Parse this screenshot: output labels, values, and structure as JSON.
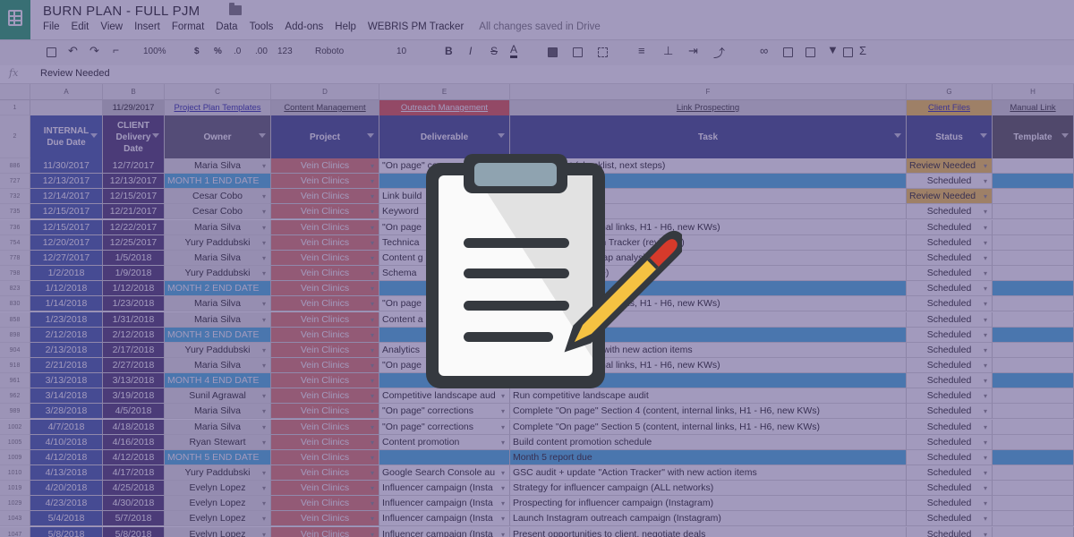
{
  "doc": {
    "title": "BURN PLAN - FULL PJM",
    "menu": [
      "File",
      "Edit",
      "View",
      "Insert",
      "Format",
      "Data",
      "Tools",
      "Add-ons",
      "Help",
      "WEBRIS PM Tracker"
    ],
    "saved_status": "All changes saved in Drive"
  },
  "toolbar": {
    "zoom": "100%",
    "currency": "$",
    "percent": "%",
    "dec_less": ".0",
    "dec_more": ".00",
    "format_more": "123",
    "font": "Roboto",
    "font_size": "10",
    "bold": "B",
    "italic": "I",
    "strike": "S",
    "text_color": "A",
    "sum": "Σ"
  },
  "formula": {
    "fx_label": "fx",
    "value": "Review Needed"
  },
  "columns": [
    "A",
    "B",
    "C",
    "D",
    "E",
    "F",
    "G",
    "H"
  ],
  "row1": {
    "row_number": "1",
    "b": "11/29/2017",
    "c": "Project Plan Templates",
    "d": "Content Management",
    "e": "Outreach Management",
    "f": "Link Prospecting",
    "g": "Client Files",
    "h": "Manual Link"
  },
  "headers": {
    "row_number": "2",
    "a": "INTERNAL Due Date",
    "b": "CLIENT Delivery Date",
    "c": "Owner",
    "d": "Project",
    "e": "Deliverable",
    "f": "Task",
    "g": "Status",
    "h": "Template"
  },
  "rows": [
    {
      "n": "886",
      "a": "11/30/2017",
      "b": "12/7/2017",
      "c": "Maria Silva",
      "d": "Vein Clinics",
      "e": "\"On page\" co",
      "f": "ead document (checklist, next steps)",
      "g": "Review Needed"
    },
    {
      "n": "727",
      "a": "12/13/2017",
      "b": "12/13/2017",
      "c": "MONTH 1 END DATE",
      "d": "Vein Clinics",
      "e": "",
      "f": "",
      "g": "Scheduled",
      "m": true
    },
    {
      "n": "732",
      "a": "12/14/2017",
      "b": "12/15/2017",
      "c": "Cesar Cobo",
      "d": "Vein Clinics",
      "e": "Link build",
      "f": "ategy deck",
      "g": "Review Needed"
    },
    {
      "n": "735",
      "a": "12/15/2017",
      "b": "12/21/2017",
      "c": "Cesar Cobo",
      "d": "Vein Clinics",
      "e": "Keyword",
      "f": "",
      "g": "Scheduled"
    },
    {
      "n": "736",
      "a": "12/15/2017",
      "b": "12/22/2017",
      "c": "Maria Silva",
      "d": "Vein Clinics",
      "e": "\"On page",
      "f": "ction 1 (content, internal links, H1 - H6, new KWs)",
      "g": "Scheduled"
    },
    {
      "n": "754",
      "a": "12/20/2017",
      "b": "12/25/2017",
      "c": "Yury Paddubski",
      "d": "Vein Clinics",
      "e": "Technica",
      "f": "cklist) + Update Action Tracker (reviewer)",
      "g": "Scheduled"
    },
    {
      "n": "778",
      "a": "12/27/2017",
      "b": "1/5/2018",
      "c": "Maria Silva",
      "d": "Vein Clinics",
      "e": "Content g",
      "f": "tions (based on KW gap analysis)",
      "g": "Scheduled"
    },
    {
      "n": "798",
      "a": "1/2/2018",
      "b": "1/9/2018",
      "c": "Yury Paddubski",
      "d": "Vein Clinics",
      "e": "Schema",
      "f": "ndations File (sitewide)",
      "g": "Scheduled"
    },
    {
      "n": "823",
      "a": "1/12/2018",
      "b": "1/12/2018",
      "c": "MONTH 2 END DATE",
      "d": "Vein Clinics",
      "e": "",
      "f": "",
      "g": "Scheduled",
      "m": true
    },
    {
      "n": "830",
      "a": "1/14/2018",
      "b": "1/23/2018",
      "c": "Maria Silva",
      "d": "Vein Clinics",
      "e": "\"On page",
      "f": "ction 2 (content, internal links, H1 - H6, new KWs)",
      "g": "Scheduled"
    },
    {
      "n": "858",
      "a": "1/23/2018",
      "b": "1/31/2018",
      "c": "Maria Silva",
      "d": "Vein Clinics",
      "e": "Content a",
      "f": "posts) use WQA",
      "g": "Scheduled"
    },
    {
      "n": "898",
      "a": "2/12/2018",
      "b": "2/12/2018",
      "c": "MONTH 3 END DATE",
      "d": "Vein Clinics",
      "e": "",
      "f": "",
      "g": "Scheduled",
      "m": true
    },
    {
      "n": "904",
      "a": "2/13/2018",
      "b": "2/17/2018",
      "c": "Yury Paddubski",
      "d": "Vein Clinics",
      "e": "Analytics",
      "f": "date \"Action Tracker\" with new action items",
      "g": "Scheduled"
    },
    {
      "n": "918",
      "a": "2/21/2018",
      "b": "2/27/2018",
      "c": "Maria Silva",
      "d": "Vein Clinics",
      "e": "\"On page",
      "f": "ction 3 (content, internal links, H1 - H6, new KWs)",
      "g": "Scheduled"
    },
    {
      "n": "961",
      "a": "3/13/2018",
      "b": "3/13/2018",
      "c": "MONTH 4 END DATE",
      "d": "Vein Clinics",
      "e": "",
      "f": "",
      "g": "Scheduled",
      "m": true
    },
    {
      "n": "962",
      "a": "3/14/2018",
      "b": "3/19/2018",
      "c": "Sunil Agrawal",
      "d": "Vein Clinics",
      "e": "Competitive landscape aud",
      "f": "Run competitive landscape audit",
      "g": "Scheduled"
    },
    {
      "n": "989",
      "a": "3/28/2018",
      "b": "4/5/2018",
      "c": "Maria Silva",
      "d": "Vein Clinics",
      "e": "\"On page\" corrections",
      "f": "Complete \"On page\" Section 4 (content, internal links, H1 - H6, new KWs)",
      "g": "Scheduled"
    },
    {
      "n": "1002",
      "a": "4/7/2018",
      "b": "4/18/2018",
      "c": "Maria Silva",
      "d": "Vein Clinics",
      "e": "\"On page\" corrections",
      "f": "Complete \"On page\" Section 5 (content, internal links, H1 - H6, new KWs)",
      "g": "Scheduled"
    },
    {
      "n": "1005",
      "a": "4/10/2018",
      "b": "4/16/2018",
      "c": "Ryan Stewart",
      "d": "Vein Clinics",
      "e": "Content promotion",
      "f": "Build content promotion schedule",
      "g": "Scheduled"
    },
    {
      "n": "1009",
      "a": "4/12/2018",
      "b": "4/12/2018",
      "c": "MONTH 5 END DATE",
      "d": "Vein Clinics",
      "e": "",
      "f": "Month 5 report due",
      "g": "Scheduled",
      "m": true
    },
    {
      "n": "1010",
      "a": "4/13/2018",
      "b": "4/17/2018",
      "c": "Yury Paddubski",
      "d": "Vein Clinics",
      "e": "Google Search Console au",
      "f": "GSC audit  + update \"Action Tracker\" with new action items",
      "g": "Scheduled"
    },
    {
      "n": "1019",
      "a": "4/20/2018",
      "b": "4/25/2018",
      "c": "Evelyn Lopez",
      "d": "Vein Clinics",
      "e": "Influencer campaign (Insta",
      "f": "Strategy for influencer campaign (ALL networks)",
      "g": "Scheduled"
    },
    {
      "n": "1029",
      "a": "4/23/2018",
      "b": "4/30/2018",
      "c": "Evelyn Lopez",
      "d": "Vein Clinics",
      "e": "Influencer campaign (Insta",
      "f": "Prospecting for influencer campaign (Instagram)",
      "g": "Scheduled"
    },
    {
      "n": "1043",
      "a": "5/4/2018",
      "b": "5/7/2018",
      "c": "Evelyn Lopez",
      "d": "Vein Clinics",
      "e": "Influencer campaign (Insta",
      "f": "Launch Instagram outreach campaign (Instagram)",
      "g": "Scheduled"
    },
    {
      "n": "1047",
      "a": "5/8/2018",
      "b": "5/8/2018",
      "c": "Evelyn Lopez",
      "d": "Vein Clinics",
      "e": "Influencer campaign (Insta",
      "f": "Present opportunities to client, negotiate deals",
      "g": "Scheduled"
    }
  ],
  "colors": {
    "overlay": "#4c3e80",
    "date_col": "#3f5aa8",
    "client_date_col": "#4a3a70",
    "owner_col": "#e6e6e6",
    "project_col": "#e07a6c",
    "header": "#3e4a8a",
    "month_row": "#48b3df",
    "review_needed": "#f7c94b",
    "clipboard_pencil": "#f5c242",
    "pencil_tip": "#d63a2b"
  }
}
